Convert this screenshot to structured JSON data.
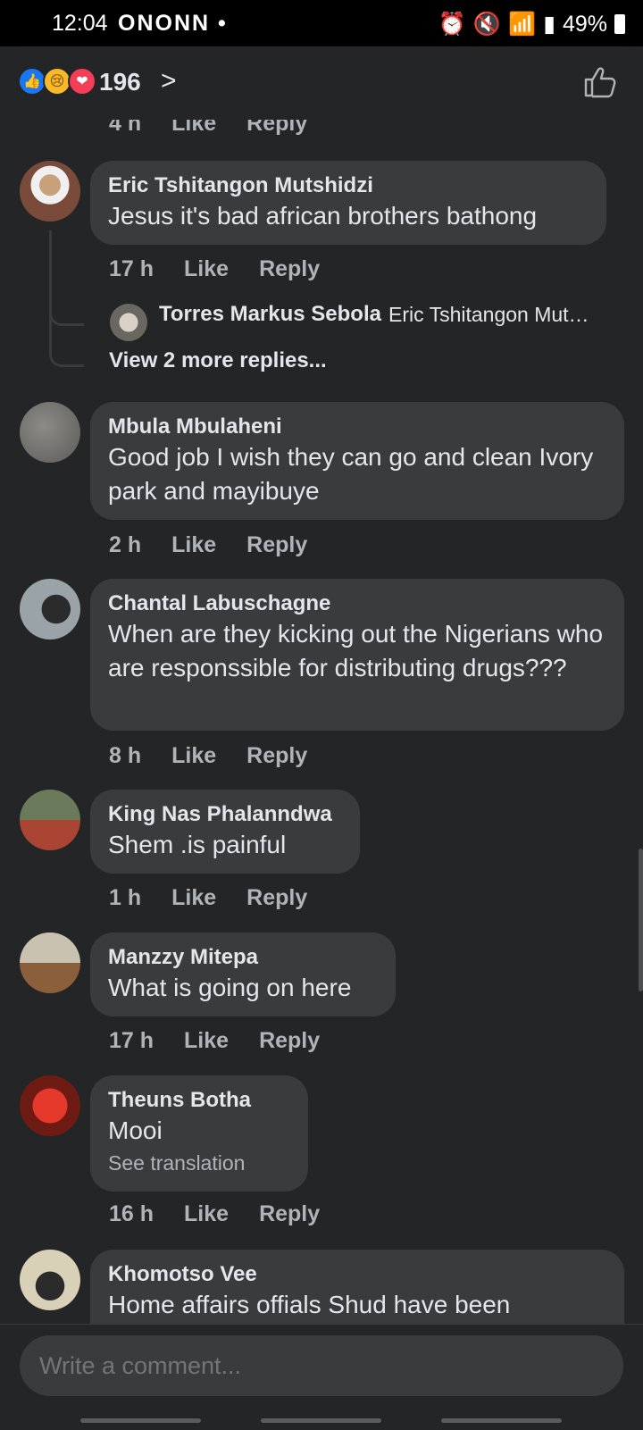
{
  "status_bar": {
    "time": "12:04",
    "app_icons": "ONONN •",
    "battery_percent": "49%"
  },
  "header": {
    "reaction_count": "196",
    "reactions": [
      "like",
      "sad",
      "love"
    ]
  },
  "partial_meta": {
    "time": "4 h",
    "like": "Like",
    "reply": "Reply"
  },
  "comments": [
    {
      "name": "Eric Tshitangon Mutshidzi",
      "text": "Jesus it's bad african brothers bathong",
      "time": "17 h",
      "like": "Like",
      "reply": "Reply"
    },
    {
      "name": "Mbula Mbulaheni",
      "text": "Good job I wish they can go and clean Ivory park and mayibuye",
      "time": "2 h",
      "like": "Like",
      "reply": "Reply"
    },
    {
      "name": "Chantal Labuschagne",
      "text": "When are they kicking out the Nigerians who are responssible for distributing drugs???",
      "time": "8 h",
      "like": "Like",
      "reply": "Reply"
    },
    {
      "name": "King Nas Phalanndwa",
      "text": "Shem .is painful",
      "time": "1 h",
      "like": "Like",
      "reply": "Reply"
    },
    {
      "name": "Manzzy Mitepa",
      "text": "What is going on here",
      "time": "17 h",
      "like": "Like",
      "reply": "Reply"
    },
    {
      "name": "Theuns Botha",
      "text": "Mooi",
      "translation": "See translation",
      "time": "16 h",
      "like": "Like",
      "reply": "Reply"
    },
    {
      "name": "Khomotso Vee",
      "text": "Home affairs offials Shud have been"
    }
  ],
  "reply_preview": {
    "name": "Torres Markus Sebola",
    "snippet": "Eric Tshitangon Mut…",
    "view_more": "View 2 more replies..."
  },
  "composer": {
    "placeholder": "Write a comment..."
  }
}
